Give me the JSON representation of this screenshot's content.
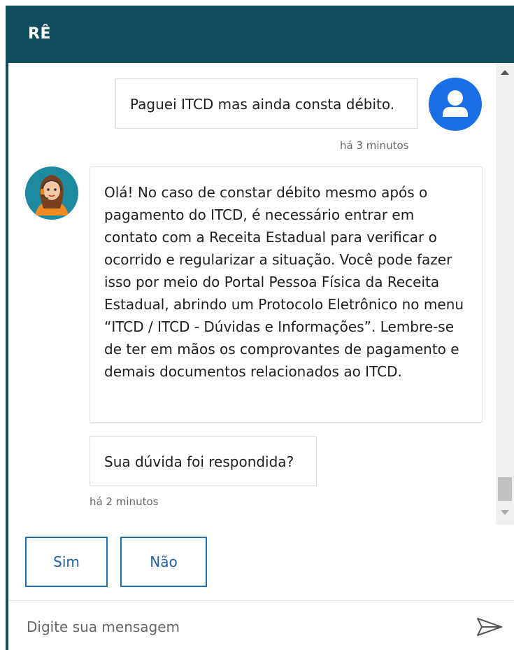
{
  "header": {
    "title": "RÊ"
  },
  "messages": {
    "user": {
      "text": "Paguei ITCD mas ainda consta débito.",
      "time": "há 3 minutos"
    },
    "bot": {
      "text": "Olá! No caso de constar débito mesmo após o pagamento do ITCD, é necessário entrar em contato com a Receita Estadual para verificar o ocorrido e regularizar a situação. Você pode fazer isso por meio do Portal Pessoa Física da Receita Estadual, abrindo um Protocolo Eletrônico no menu “ITCD / ITCD - Dúvidas e Informações”. Lembre-se de ter em mãos os comprovantes de pagamento e demais documentos relacionados ao ITCD.",
      "question": "Sua dúvida foi respondida?",
      "time": "há 2 minutos"
    }
  },
  "quick_replies": {
    "yes": "Sim",
    "no": "Não"
  },
  "composer": {
    "placeholder": "Digite sua mensagem"
  },
  "colors": {
    "header": "#0e4c5e",
    "accent": "#1f6fb5",
    "user_avatar": "#1a6ee6"
  },
  "icons": {
    "user_avatar": "user-avatar-icon",
    "bot_avatar": "bot-avatar-icon",
    "send": "send-icon"
  }
}
